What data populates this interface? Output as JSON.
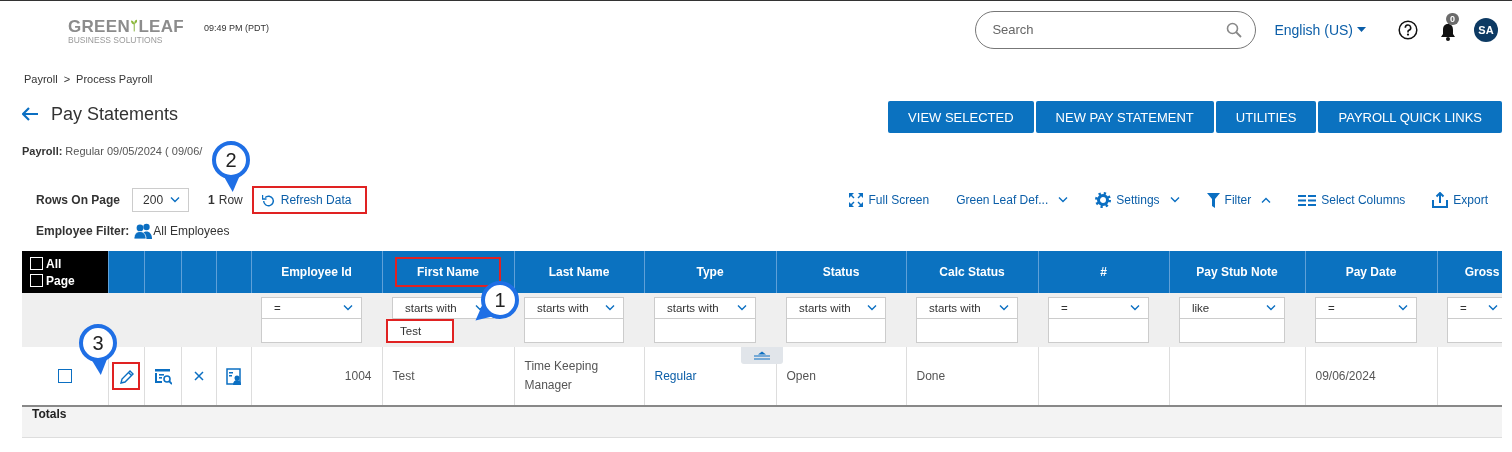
{
  "header": {
    "logo": {
      "word_1": "GREEN",
      "word_2": "LEAF",
      "tagline": "BUSINESS SOLUTIONS"
    },
    "time": "09:49 PM (PDT)",
    "search": {
      "placeholder": "Search"
    },
    "language": "English (US)",
    "notifications": {
      "count": "0"
    },
    "avatar": "SA"
  },
  "breadcrumb": {
    "items": [
      "Payroll",
      "Process Payroll"
    ],
    "separator": ">"
  },
  "title": "Pay Statements",
  "actions": [
    "VIEW SELECTED",
    "NEW PAY STATEMENT",
    "UTILITIES",
    "PAYROLL QUICK LINKS"
  ],
  "payroll": {
    "label": "Payroll:",
    "value": "Regular 09/05/2024 ( 09/06/"
  },
  "toolbar": {
    "rows_label": "Rows On Page",
    "rows_per_page": "200",
    "row_count": "1",
    "row_unit": "Row",
    "refresh": {
      "label": "Refresh Data",
      "highlighted": true
    },
    "tools": [
      {
        "kind": "fullscreen",
        "label": "Full Screen",
        "dropdown": false
      },
      {
        "kind": "view",
        "label": "Green Leaf Def...",
        "dropdown": true,
        "expanded": false
      },
      {
        "kind": "settings",
        "label": "Settings",
        "dropdown": true,
        "expanded": false
      },
      {
        "kind": "filter",
        "label": "Filter",
        "dropdown": true,
        "expanded": true
      },
      {
        "kind": "columns",
        "label": "Select Columns",
        "dropdown": false
      },
      {
        "kind": "export",
        "label": "Export",
        "dropdown": false
      }
    ]
  },
  "employee_filter": {
    "label": "Employee Filter:",
    "value": "All Employees"
  },
  "grid": {
    "select_all": [
      {
        "label": "All",
        "checked": false
      },
      {
        "label": "Page",
        "checked": false
      }
    ],
    "columns": [
      {
        "label": "Employee Id",
        "operator": "=",
        "highlighted": false
      },
      {
        "label": "First Name",
        "operator": "starts with",
        "value": "Test",
        "highlighted": true,
        "value_highlighted": true
      },
      {
        "label": "Last Name",
        "operator": "starts with",
        "highlighted": false
      },
      {
        "label": "Type",
        "operator": "starts with",
        "highlighted": false
      },
      {
        "label": "Status",
        "operator": "starts with",
        "highlighted": false
      },
      {
        "label": "Calc Status",
        "operator": "starts with",
        "highlighted": false
      },
      {
        "label": "#",
        "operator": "=",
        "highlighted": false
      },
      {
        "label": "Pay Stub Note",
        "operator": "like",
        "highlighted": false
      },
      {
        "label": "Pay Date",
        "operator": "=",
        "highlighted": false
      },
      {
        "label": "Gross",
        "operator": "=",
        "highlighted": false
      }
    ],
    "rows": [
      {
        "checked": false,
        "actions": [
          {
            "kind": "edit",
            "highlighted": true
          },
          {
            "kind": "view",
            "highlighted": false
          },
          {
            "kind": "delete",
            "highlighted": false
          },
          {
            "kind": "profile",
            "highlighted": false
          }
        ],
        "cells": [
          {
            "text": "1004",
            "kind": "number"
          },
          {
            "text": "Test",
            "kind": "text"
          },
          {
            "text": "Time Keeping Manager",
            "kind": "text"
          },
          {
            "text": "Regular",
            "kind": "link"
          },
          {
            "text": "Open",
            "kind": "text"
          },
          {
            "text": "Done",
            "kind": "text"
          },
          null,
          null,
          {
            "text": "09/06/2024",
            "kind": "text"
          },
          null
        ]
      }
    ],
    "totals_label": "Totals"
  },
  "annotations": [
    {
      "label": "1"
    },
    {
      "label": "2"
    },
    {
      "label": "3"
    }
  ]
}
